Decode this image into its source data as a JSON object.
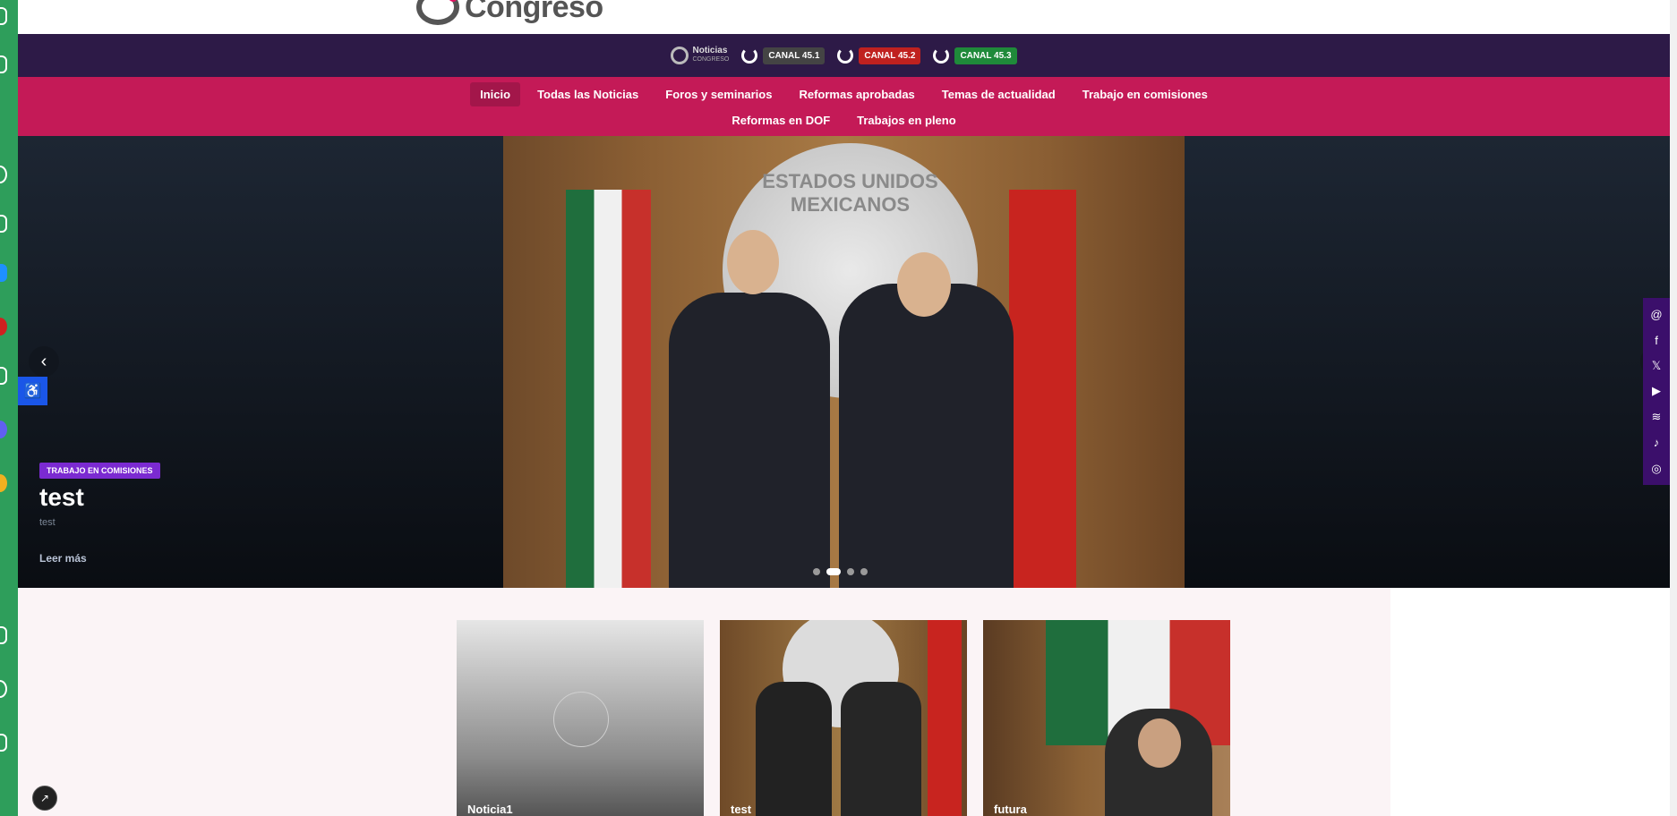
{
  "header": {
    "logo_text": "Congreso"
  },
  "channels": {
    "brand_line1": "Noticias",
    "brand_line2": "CONGRESO",
    "items": [
      {
        "label": "CANAL 45.1",
        "color": "#444444"
      },
      {
        "label": "CANAL 45.2",
        "color": "#c0211f"
      },
      {
        "label": "CANAL 45.3",
        "color": "#1f8a3a"
      }
    ]
  },
  "nav": {
    "row1": [
      "Inicio",
      "Todas las Noticias",
      "Foros y seminarios",
      "Reformas aprobadas",
      "Temas de actualidad",
      "Trabajo en comisiones"
    ],
    "row2": [
      "Reformas en DOF",
      "Trabajos en pleno"
    ],
    "active": "Inicio"
  },
  "hero": {
    "category": "TRABAJO EN COMISIONES",
    "title": "test",
    "subtitle": "test",
    "read_more": "Leer más",
    "seal_text": "ESTADOS UNIDOS MEXICANOS",
    "dots": 4,
    "active_dot": 2
  },
  "accessibility": {
    "icon": "accessibility-icon"
  },
  "social": [
    "threads-icon",
    "facebook-icon",
    "x-icon",
    "youtube-icon",
    "spotify-icon",
    "tiktok-icon",
    "instagram-icon"
  ],
  "cards": [
    {
      "title": "Noticia1"
    },
    {
      "title": "test"
    },
    {
      "title": "futura"
    }
  ],
  "colors": {
    "channel_bar": "#2d1a47",
    "nav_bar": "#c41a57",
    "accent": "#7b2ad1"
  }
}
